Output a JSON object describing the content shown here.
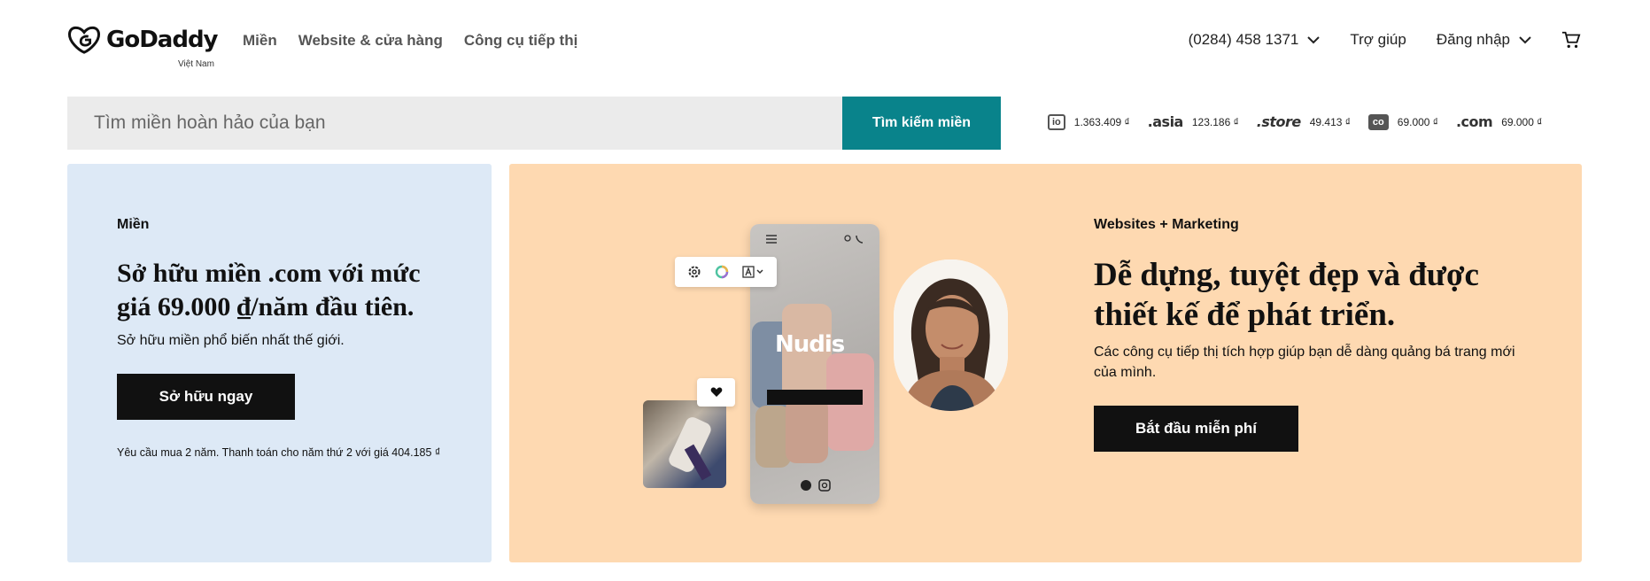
{
  "header": {
    "brand": "GoDaddy",
    "brand_sub": "Việt Nam",
    "nav": [
      "Miền",
      "Website & cửa hàng",
      "Công cụ tiếp thị"
    ],
    "phone": "(0284) 458 1371",
    "help": "Trợ giúp",
    "login": "Đăng nhập"
  },
  "search": {
    "placeholder": "Tìm miền hoàn hảo của bạn",
    "button": "Tìm kiếm miền"
  },
  "tlds": [
    {
      "name": "io",
      "price": "1.363.409 ₫"
    },
    {
      "name": ".asia",
      "price": "123.186 ₫"
    },
    {
      "name": ".store",
      "price": "49.413 ₫"
    },
    {
      "name": "co",
      "price": "69.000 ₫"
    },
    {
      "name": ".com",
      "price": "69.000 ₫"
    }
  ],
  "promo_left": {
    "eyebrow": "Miền",
    "headline": "Sở hữu miền .com với mức giá 69.000 ₫/năm đầu tiên.",
    "body": "Sở hữu miền phổ biến nhất thế giới.",
    "cta": "Sở hữu ngay",
    "note": "Yêu cầu mua 2 năm. Thanh toán cho năm thứ 2 với giá 404.185 ₫"
  },
  "promo_right": {
    "eyebrow": "Websites + Marketing",
    "headline": "Dễ dựng, tuyệt đẹp và được thiết kế để phát triển.",
    "body": "Các công cụ tiếp thị tích hợp giúp bạn dễ dàng quảng bá trang mới của mình.",
    "cta": "Bắt đầu miễn phí",
    "phone_brand": "Nudis"
  },
  "colors": {
    "accent": "#09838b",
    "left_panel": "#dde9f6",
    "right_panel": "#fed9b1",
    "cta": "#111111"
  }
}
